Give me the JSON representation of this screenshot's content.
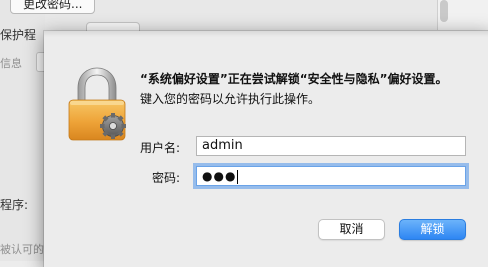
{
  "background": {
    "top_button_label": "更改密码...",
    "protect_label": "保护程",
    "info_label": "信息",
    "program_label": "程序:",
    "allow_label": "被认可的"
  },
  "dialog": {
    "title_line": "“系统偏好设置”正在尝试解锁“安全性与隐私”偏好设置。",
    "body_line": "键入您的密码以允许执行此操作。",
    "username_label": "用户名:",
    "username_value": "admin",
    "password_label": "密码:",
    "password_masked": "●●●",
    "cancel_label": "取消",
    "unlock_label": "解锁"
  },
  "colors": {
    "accent": "#2e86f3",
    "focus_ring": "#6aa3e8",
    "lock_gold": "#f2a93b"
  },
  "icons": {
    "lock": "lock-icon"
  }
}
